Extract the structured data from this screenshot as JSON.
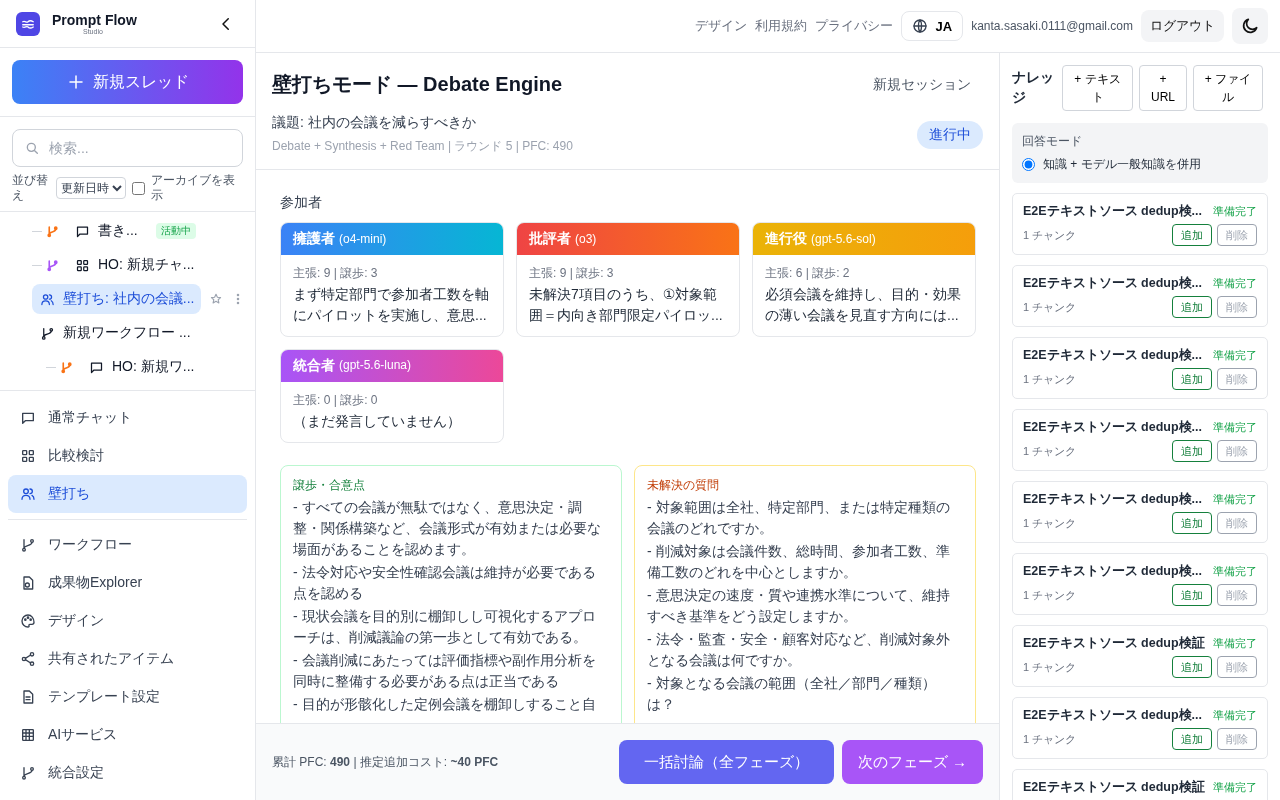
{
  "brand": {
    "name": "Prompt Flow",
    "sub": "Studio"
  },
  "new_thread": "新規スレッド",
  "search": {
    "placeholder": "検索..."
  },
  "sort": {
    "label": "並び替え",
    "value": "更新日時"
  },
  "archive": {
    "label": "アーカイブを表示",
    "checked": false
  },
  "tree": [
    {
      "label": "書き...",
      "kind": "chat",
      "color": "#f97316",
      "badge": "活動中",
      "selected": false
    },
    {
      "label": "HO: 新規チャ...",
      "kind": "compare",
      "color": "#a855f7",
      "selected": false
    },
    {
      "label": "壁打ち: 社内の会議...",
      "kind": "debate",
      "selected": true
    },
    {
      "label": "新規ワークフロー ...",
      "kind": "workflow",
      "selected": false,
      "children": [
        {
          "label": "HO: 新規ワ...",
          "kind": "chat",
          "color": "#f97316",
          "selected": false
        }
      ]
    }
  ],
  "nav_primary": [
    {
      "label": "通常チャット",
      "kind": "chat",
      "selected": false
    },
    {
      "label": "比較検討",
      "kind": "compare",
      "selected": false
    },
    {
      "label": "壁打ち",
      "kind": "debate",
      "selected": true
    }
  ],
  "nav_secondary": [
    {
      "label": "ワークフロー",
      "kind": "workflow",
      "selected": false
    },
    {
      "label": "成果物Explorer",
      "kind": "artifact",
      "selected": false
    },
    {
      "label": "デザイン",
      "kind": "design",
      "selected": false
    },
    {
      "label": "共有されたアイテム",
      "kind": "shared",
      "selected": false
    },
    {
      "label": "テンプレート設定",
      "kind": "template",
      "selected": false
    },
    {
      "label": "AIサービス",
      "kind": "service",
      "selected": false
    },
    {
      "label": "統合設定",
      "kind": "workflow",
      "selected": false
    }
  ],
  "topbar": {
    "links": [
      "デザイン",
      "利用規約",
      "プライバシー"
    ],
    "language": "JA",
    "email": "kanta.sasaki.0111@gmail.com",
    "logout": "ログアウト"
  },
  "session": {
    "title": "壁打ちモード — Debate Engine",
    "new_session": "新規セッション",
    "topic": "議題: 社内の会議を減らすべきか",
    "meta": "Debate + Synthesis + Red Team | ラウンド 5 | PFC: 490",
    "status": "進行中"
  },
  "participants_label": "参加者",
  "participants": [
    {
      "kind": "advocate",
      "role": "擁護者",
      "model": "(o4-mini)",
      "stats": "主張: 9 | 譲歩: 3",
      "text": "まず特定部門で参加者工数を軸にパイロットを実施し、意思..."
    },
    {
      "kind": "critic",
      "role": "批評者",
      "model": "(o3)",
      "stats": "主張: 9 | 譲歩: 3",
      "text": "未解決7項目のうち、①対象範囲＝内向き部門限定パイロッ..."
    },
    {
      "kind": "moderator",
      "role": "進行役",
      "model": "(gpt-5.6-sol)",
      "stats": "主張: 6 | 譲歩: 2",
      "text": "必須会議を維持し、目的・効果の薄い会議を見直す方向には..."
    },
    {
      "kind": "integrator",
      "role": "統合者",
      "model": "(gpt-5.6-luna)",
      "stats": "主張: 0 | 譲歩: 0",
      "text": "（まだ発言していません）"
    }
  ],
  "panels": [
    {
      "kind": "agreement",
      "title": "譲歩・合意点",
      "items": [
        "- すべての会議が無駄ではなく、意思決定・調整・関係構築など、会議形式が有効または必要な場面があることを認めます。",
        "- 法令対応や安全性確認会議は維持が必要である点を認める",
        "- 現状会議を目的別に棚卸しし可視化するアプローチは、削減議論の第一歩として有効である。",
        "- 会議削減にあたっては評価指標や副作用分析を同時に整備する必要がある点は正当である",
        "- 目的が形骸化した定例会議を棚卸しすること自"
      ]
    },
    {
      "kind": "open",
      "title": "未解決の質問",
      "items": [
        "- 対象範囲は全社、特定部門、または特定種類の会議のどれですか。",
        "- 削減対象は会議件数、総時間、参加者工数、準備工数のどれを中心としますか。",
        "- 意思決定の速度・質や連携水準について、維持すべき基準をどう設定しますか。",
        "- 法令・監査・安全・顧客対応など、削減対象外となる会議は何ですか。",
        "- 対象となる会議の範囲（全社／部門／種類）は？"
      ]
    }
  ],
  "footer": {
    "summary": "累計 PFC: **490** | 推定追加コスト: **~40 PFC**",
    "run_all": "一括討論（全フェーズ）",
    "next": "次のフェーズ →"
  },
  "knowledge": {
    "title": "ナレッジ",
    "add_buttons": [
      "+ テキスト",
      "+ URL",
      "+ ファイル"
    ],
    "mode_label": "回答モード",
    "mode_option": {
      "label": "知識 + モデル一般知識を併用",
      "selected": true
    },
    "items": [
      {
        "title": "E2Eテキストソース dedup検...",
        "status": "準備完了",
        "chunks": "1 チャンク",
        "add": "追加",
        "remove": "削除"
      },
      {
        "title": "E2Eテキストソース dedup検...",
        "status": "準備完了",
        "chunks": "1 チャンク",
        "add": "追加",
        "remove": "削除"
      },
      {
        "title": "E2Eテキストソース dedup検...",
        "status": "準備完了",
        "chunks": "1 チャンク",
        "add": "追加",
        "remove": "削除"
      },
      {
        "title": "E2Eテキストソース dedup検...",
        "status": "準備完了",
        "chunks": "1 チャンク",
        "add": "追加",
        "remove": "削除"
      },
      {
        "title": "E2Eテキストソース dedup検...",
        "status": "準備完了",
        "chunks": "1 チャンク",
        "add": "追加",
        "remove": "削除"
      },
      {
        "title": "E2Eテキストソース dedup検...",
        "status": "準備完了",
        "chunks": "1 チャンク",
        "add": "追加",
        "remove": "削除"
      },
      {
        "title": "E2Eテキストソース dedup検証",
        "status": "準備完了",
        "chunks": "1 チャンク",
        "add": "追加",
        "remove": "削除"
      },
      {
        "title": "E2Eテキストソース dedup検...",
        "status": "準備完了",
        "chunks": "1 チャンク",
        "add": "追加",
        "remove": "削除"
      },
      {
        "title": "E2Eテキストソース dedup検証",
        "status": "準備完了"
      }
    ]
  }
}
